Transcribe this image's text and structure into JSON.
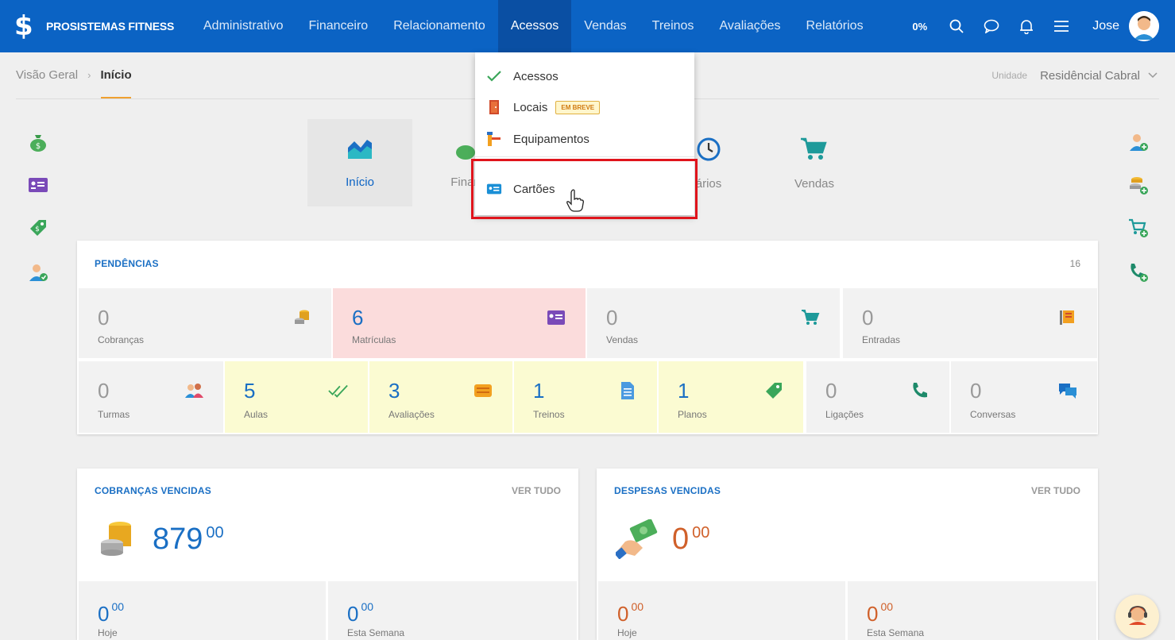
{
  "app": {
    "name": "PROSISTEMAS FITNESS"
  },
  "nav": {
    "items": [
      "Administrativo",
      "Financeiro",
      "Relacionamento",
      "Acessos",
      "Vendas",
      "Treinos",
      "Avaliações",
      "Relatórios"
    ],
    "active": "Acessos",
    "progress": "0%",
    "user": "Jose"
  },
  "breadcrumb": {
    "parent": "Visão Geral",
    "current": "Início"
  },
  "unit": {
    "label": "Unidade",
    "value": "Residêncial Cabral"
  },
  "modules": [
    {
      "label": "Início",
      "icon": "chart-area-icon"
    },
    {
      "label": "Finan",
      "icon": "money-bag-icon"
    },
    {
      "label": "ários",
      "icon": "clock-icon"
    },
    {
      "label": "Vendas",
      "icon": "cart-icon"
    }
  ],
  "dropdown": {
    "items": [
      {
        "label": "Acessos",
        "icon": "check-icon"
      },
      {
        "label": "Locais",
        "icon": "door-icon",
        "badge": "EM BREVE"
      },
      {
        "label": "Equipamentos",
        "icon": "turnstile-icon"
      },
      {
        "label": "Cartões",
        "icon": "id-card-icon"
      }
    ]
  },
  "pendencias": {
    "title": "PENDÊNCIAS",
    "count": "16",
    "row1": [
      {
        "value": "0",
        "label": "Cobranças",
        "icon": "coins-icon"
      },
      {
        "value": "6",
        "label": "Matrículas",
        "icon": "id-badge-icon"
      },
      {
        "value": "0",
        "label": "Vendas",
        "icon": "cart-icon"
      },
      {
        "value": "0",
        "label": "Entradas",
        "icon": "turnstile-icon"
      }
    ],
    "row2": [
      {
        "value": "0",
        "label": "Turmas",
        "icon": "group-icon"
      },
      {
        "value": "5",
        "label": "Aulas",
        "icon": "double-check-icon"
      },
      {
        "value": "3",
        "label": "Avaliações",
        "icon": "tape-measure-icon"
      },
      {
        "value": "1",
        "label": "Treinos",
        "icon": "document-icon"
      },
      {
        "value": "1",
        "label": "Planos",
        "icon": "price-tag-icon"
      },
      {
        "value": "0",
        "label": "Ligações",
        "icon": "phone-icon"
      },
      {
        "value": "0",
        "label": "Conversas",
        "icon": "chat-icon"
      }
    ]
  },
  "cobrancas": {
    "title": "COBRANÇAS VENCIDAS",
    "link": "VER TUDO",
    "amount": "879",
    "cents": "00",
    "hoje": {
      "value": "0",
      "cents": "00",
      "label": "Hoje"
    },
    "semana": {
      "value": "0",
      "cents": "00",
      "label": "Esta Semana"
    }
  },
  "despesas": {
    "title": "DESPESAS VENCIDAS",
    "link": "VER TUDO",
    "amount": "0",
    "cents": "00",
    "hoje": {
      "value": "0",
      "cents": "00",
      "label": "Hoje"
    },
    "semana": {
      "value": "0",
      "cents": "00",
      "label": "Esta Semana"
    }
  },
  "colors": {
    "brand": "#0b63c4",
    "accent": "#f0a030",
    "highlight": "#e0141c",
    "expense": "#d0602a"
  }
}
